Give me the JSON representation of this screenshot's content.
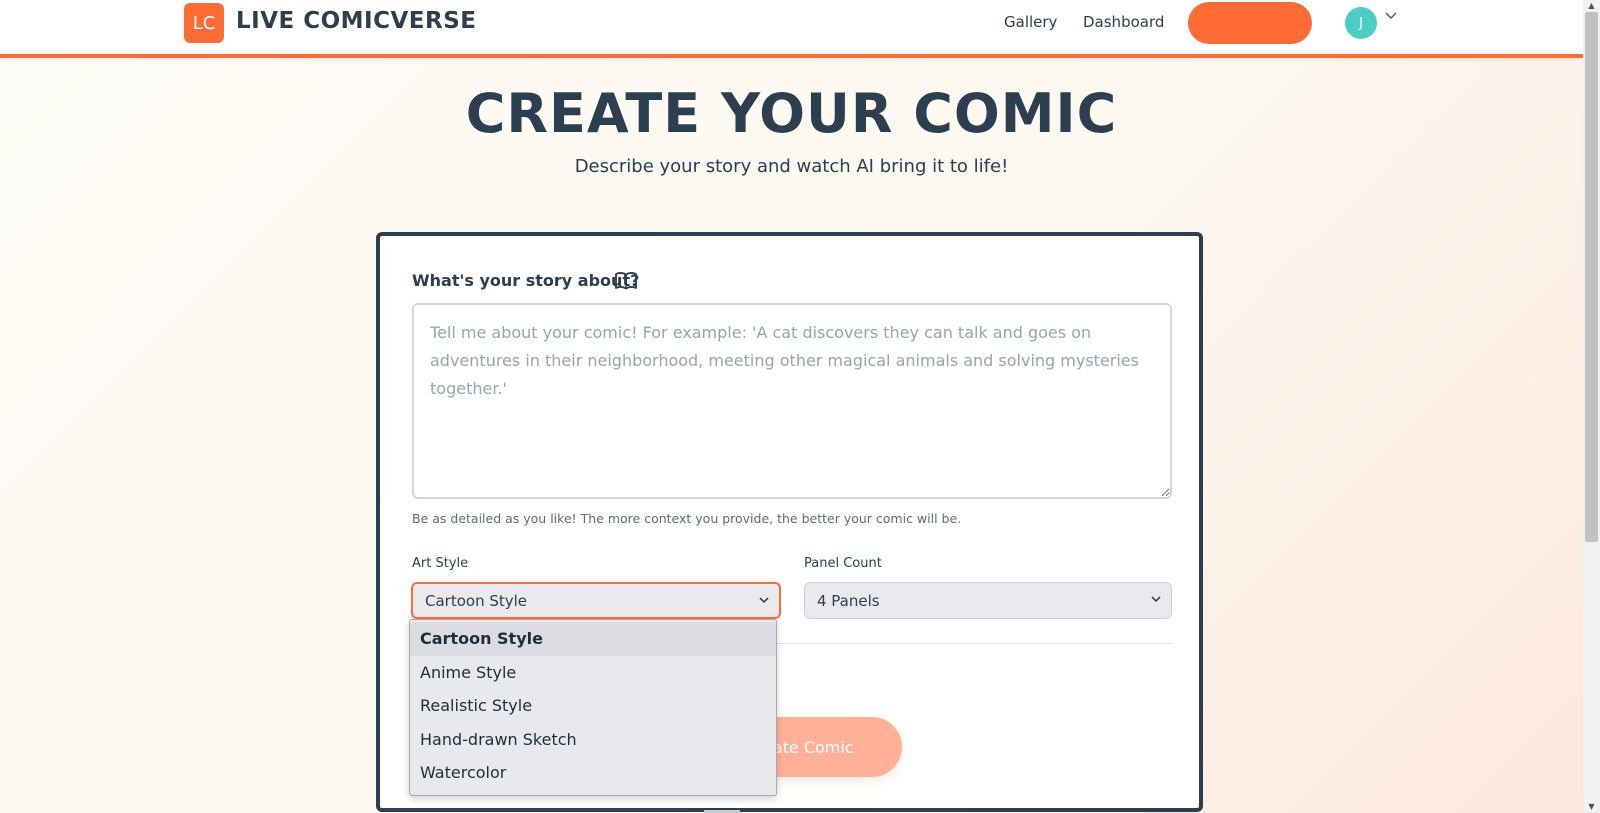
{
  "header": {
    "logo_initials": "LC",
    "brand": "LIVE COMICVERSE",
    "nav": [
      "Gallery",
      "Dashboard"
    ],
    "cta_label": "",
    "avatar_initial": "J",
    "accent_color": "#ff6b35",
    "avatar_color": "#4ecdc4"
  },
  "hero": {
    "title": "CREATE YOUR COMIC",
    "subtitle": "Describe your story and watch AI bring it to life!"
  },
  "form": {
    "story_label": "What's your story about?",
    "story_icon": "book-icon",
    "story_value": "",
    "story_placeholder": "Tell me about your comic! For example: 'A cat discovers they can talk and goes on adventures in their neighborhood, meeting other magical animals and solving mysteries together.'",
    "story_hint": "Be as detailed as you like! The more context you provide, the better your comic will be.",
    "art_style_label": "Art Style",
    "art_style_value": "Cartoon Style",
    "panel_count_label": "Panel Count",
    "panel_count_value": "4 Panels",
    "generate_label": "Generate Comic",
    "generate_label_visible": "erate Comic"
  },
  "art_style_dropdown": {
    "options": [
      "Cartoon Style",
      "Anime Style",
      "Realistic Style",
      "Hand-drawn Sketch",
      "Watercolor"
    ],
    "selected": "Cartoon Style"
  }
}
